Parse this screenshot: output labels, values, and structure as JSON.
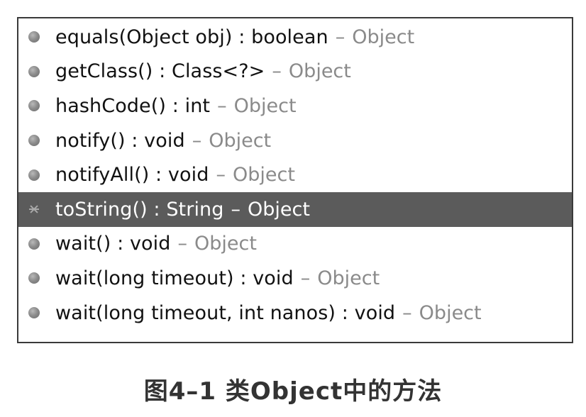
{
  "popup": {
    "items": [
      {
        "signature": "equals(Object obj) : boolean",
        "separator": "–",
        "owner": "Object",
        "icon": "public-method-icon"
      },
      {
        "signature": "getClass() : Class<?>",
        "separator": "–",
        "owner": "Object",
        "icon": "public-method-icon"
      },
      {
        "signature": "hashCode() : int",
        "separator": "–",
        "owner": "Object",
        "icon": "public-method-icon"
      },
      {
        "signature": "notify() : void",
        "separator": "–",
        "owner": "Object",
        "icon": "public-method-icon"
      },
      {
        "signature": "notifyAll() : void",
        "separator": "–",
        "owner": "Object",
        "icon": "public-method-icon"
      },
      {
        "signature": "toString() : String",
        "separator": "–",
        "owner": "Object",
        "icon": "selected-method-icon",
        "selected": true
      },
      {
        "signature": "wait() : void",
        "separator": "–",
        "owner": "Object",
        "icon": "public-method-icon"
      },
      {
        "signature": "wait(long timeout) : void",
        "separator": "–",
        "owner": "Object",
        "icon": "public-method-icon"
      },
      {
        "signature": "wait(long timeout, int nanos) : void",
        "separator": "–",
        "owner": "Object",
        "icon": "public-method-icon"
      }
    ]
  },
  "caption": "图4–1 类Object中的方法",
  "colors": {
    "selected_background": "#5b5b5b",
    "owner_text": "#8a8a8a",
    "border": "#3a3a3a"
  }
}
